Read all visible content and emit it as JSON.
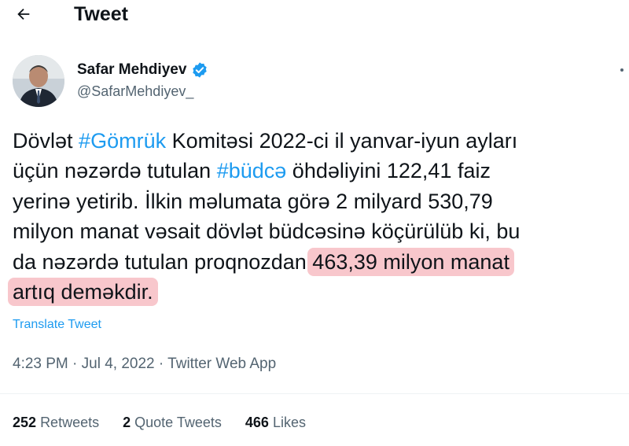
{
  "header": {
    "title": "Tweet",
    "back_icon": "arrow-left-icon"
  },
  "author": {
    "name": "Safar Mehdiyev",
    "handle": "@SafarMehdiyev_",
    "verified_icon": "verified-badge-icon",
    "verified_color": "#1d9bf0"
  },
  "tweet": {
    "lines": [
      [
        {
          "t": "Dövlət "
        },
        {
          "t": "#Gömrük",
          "c": "tag"
        },
        {
          "t": " Komitəsi 2022-ci il yanvar-iyun ayları"
        }
      ],
      [
        {
          "t": "üçün nəzərdə tutulan "
        },
        {
          "t": "#büdcə",
          "c": "tag"
        },
        {
          "t": " öhdəliyini 122,41 faiz"
        }
      ],
      [
        {
          "t": "yerinə yetirib. İlkin məlumata görə 2 milyard 530,79"
        }
      ],
      [
        {
          "t": "milyon manat vəsait dövlət büdcəsinə köçürülüb ki, bu"
        }
      ],
      [
        {
          "t": "da nəzərdə tutulan proqnozdan "
        },
        {
          "t": "463,39 milyon manat",
          "c": "hl"
        }
      ],
      [
        {
          "t": "artıq deməkdir.",
          "c": "hl"
        }
      ]
    ]
  },
  "translate_label": "Translate Tweet",
  "meta": {
    "time": "4:23 PM",
    "date": "Jul 4, 2022",
    "source": "Twitter Web App",
    "separator": "·"
  },
  "stats": {
    "retweets": {
      "count": "252",
      "label": "Retweets"
    },
    "quotes": {
      "count": "2",
      "label": "Quote Tweets"
    },
    "likes": {
      "count": "466",
      "label": "Likes"
    }
  },
  "colors": {
    "accent": "#1d9bf0",
    "highlight": "#f8c7cc",
    "text": "#0f1419",
    "muted": "#536471"
  }
}
